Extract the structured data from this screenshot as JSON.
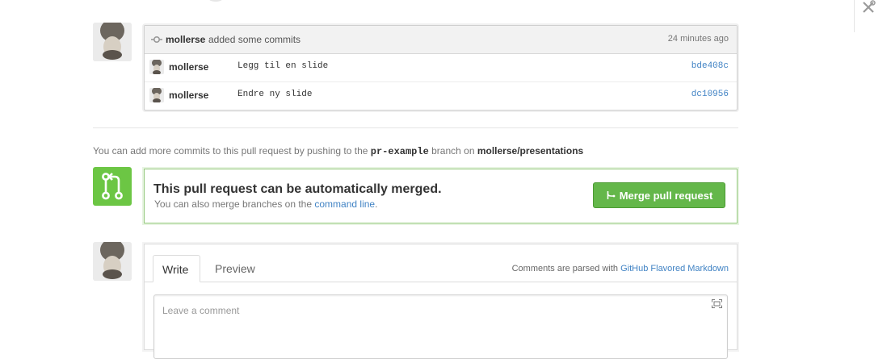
{
  "commits": {
    "author": "mollerse",
    "action": "added some commits",
    "time": "24 minutes ago",
    "items": [
      {
        "author": "mollerse",
        "message": "Legg til en slide",
        "sha": "bde408c"
      },
      {
        "author": "mollerse",
        "message": "Endre ny slide",
        "sha": "dc10956"
      }
    ]
  },
  "push_info": {
    "prefix": "You can add more commits to this pull request by pushing to the",
    "branch": "pr-example",
    "middle": "branch on",
    "repo": "mollerse/presentations"
  },
  "merge": {
    "title": "This pull request can be automatically merged.",
    "subtitle_prefix": "You can also merge branches on the",
    "subtitle_link": "command line",
    "subtitle_suffix": ".",
    "button_label": "Merge pull request"
  },
  "comment": {
    "tab_write": "Write",
    "tab_preview": "Preview",
    "markdown_prefix": "Comments are parsed with",
    "markdown_link": "GitHub Flavored Markdown",
    "placeholder": "Leave a comment"
  },
  "colors": {
    "link": "#4183c4",
    "merge_green": "#6cc644",
    "button_green": "#64b74a"
  },
  "icons": [
    "commit-icon",
    "git-merge-icon",
    "fullscreen-icon",
    "tools-icon"
  ]
}
